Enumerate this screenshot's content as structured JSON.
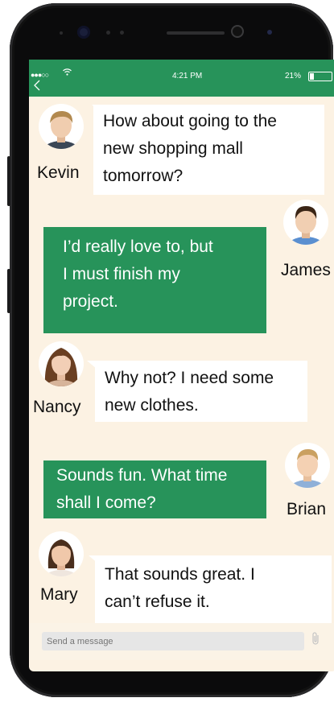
{
  "status_bar": {
    "signal": "●●●○○",
    "time": "4:21 PM",
    "battery_percent": "21%",
    "battery_level": 0.21
  },
  "messages": [
    {
      "sender": "Kevin",
      "text_lines": [
        "How about going to the",
        "new shopping mall",
        "tomorrow?"
      ],
      "side": "left"
    },
    {
      "sender": "James",
      "text_lines": [
        "I’d really love to, but",
        "I must finish my",
        "project."
      ],
      "side": "right"
    },
    {
      "sender": "Nancy",
      "text_lines": [
        "Why not? I need some",
        "new clothes."
      ],
      "side": "left"
    },
    {
      "sender": "Brian",
      "text_lines": [
        "Sounds fun. What time",
        "shall I come?"
      ],
      "side": "right"
    },
    {
      "sender": "Mary",
      "text_lines": [
        "That sounds great. I",
        "can’t refuse it."
      ],
      "side": "left"
    }
  ],
  "composer": {
    "placeholder": "Send a message",
    "attach_icon": "paperclip-icon"
  },
  "colors": {
    "accent": "#27935a",
    "background": "#fcf2e3",
    "bubble_white": "#ffffff"
  }
}
